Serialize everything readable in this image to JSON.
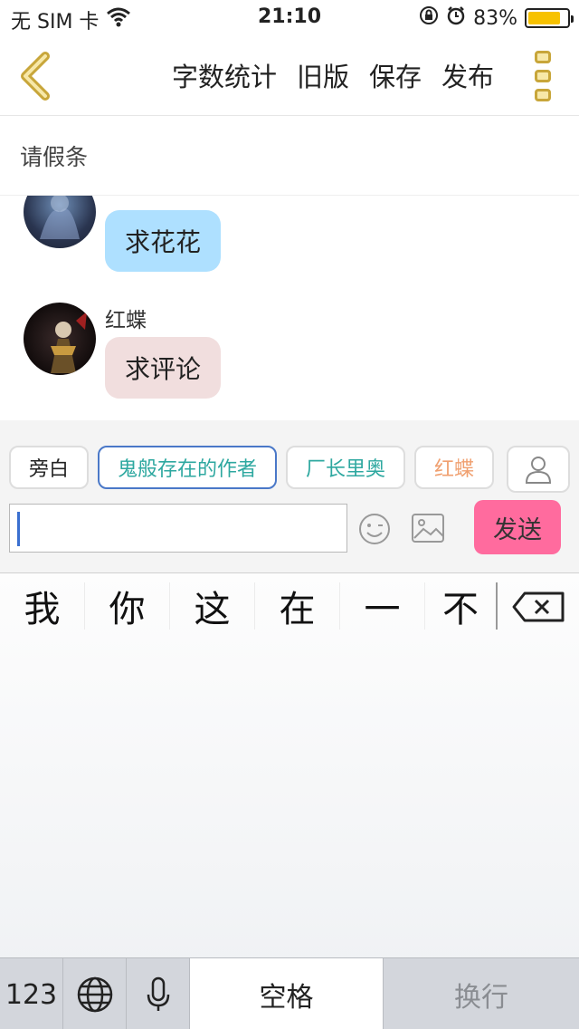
{
  "status": {
    "carrier": "无 SIM 卡",
    "time": "21:10",
    "battery": "83%",
    "battery_level": 0.83,
    "icons": [
      "wifi-icon",
      "orientation-lock-icon",
      "alarm-icon",
      "battery-icon"
    ]
  },
  "nav": {
    "back_icon": "chevron-left-icon",
    "actions": [
      "字数统计",
      "旧版",
      "保存",
      "发布"
    ],
    "menu_icon": "more-vertical-icon",
    "accent": "#c8a63a"
  },
  "story": {
    "title": "请假条"
  },
  "chat": {
    "messages": [
      {
        "sender": "",
        "text": "求花花",
        "bubble_color": "#aee0ff"
      },
      {
        "sender": "红蝶",
        "text": "求评论",
        "bubble_color": "#f1dede"
      }
    ]
  },
  "roles": {
    "chips": [
      "旁白",
      "鬼般存在的作者",
      "厂长里奥",
      "红蝶"
    ],
    "selected": "鬼般存在的作者",
    "chip_colors": [
      "#222222",
      "#2ea8a0",
      "#2ea8a0",
      "#f0a070"
    ],
    "person_icon": "person-icon"
  },
  "composer": {
    "placeholder": "",
    "emoji_icon": "emoji-icon",
    "image_icon": "image-icon",
    "send_label": "发送",
    "send_color": "#ff6b9e"
  },
  "keyboard": {
    "candidates": [
      "我",
      "你",
      "这",
      "在",
      "一",
      "不"
    ],
    "backspace_icon": "backspace-icon",
    "numbers_label": "123",
    "globe_icon": "globe-icon",
    "mic_icon": "microphone-icon",
    "space_label": "空格",
    "return_label": "换行"
  }
}
